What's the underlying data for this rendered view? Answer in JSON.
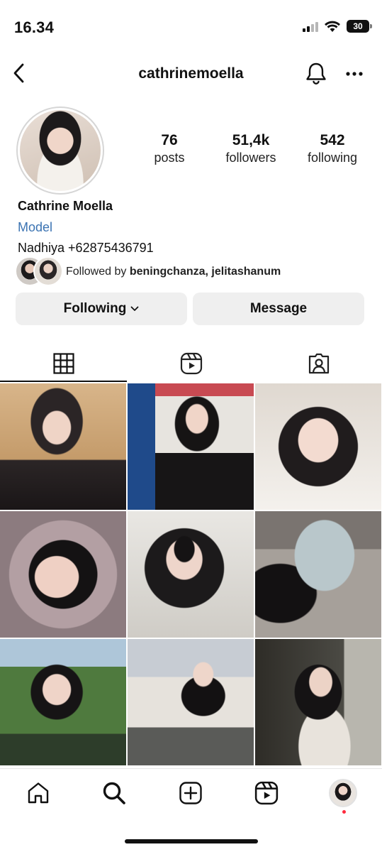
{
  "status_bar": {
    "time": "16.34",
    "battery": "30"
  },
  "header": {
    "username": "cathrinemoella"
  },
  "profile": {
    "stats": [
      {
        "value": "76",
        "label": "posts"
      },
      {
        "value": "51,4k",
        "label": "followers"
      },
      {
        "value": "542",
        "label": "following"
      }
    ],
    "name": "Cathrine Moella",
    "category": "Model",
    "bio_line": "Nadhiya +62875436791",
    "followed_by_prefix": "Followed by ",
    "followed_by_names": "beningchanza, jelitashanum"
  },
  "actions": {
    "following_label": "Following",
    "message_label": "Message"
  },
  "tabs": [
    "posts-grid-icon",
    "reels-icon",
    "tagged-icon"
  ],
  "colors": {
    "link": "#3b73b2",
    "button_bg": "#efefef",
    "notification_dot": "#ff2a3d"
  },
  "bottom_nav": [
    "home-icon",
    "search-icon",
    "create-icon",
    "reels-icon",
    "profile-avatar"
  ]
}
